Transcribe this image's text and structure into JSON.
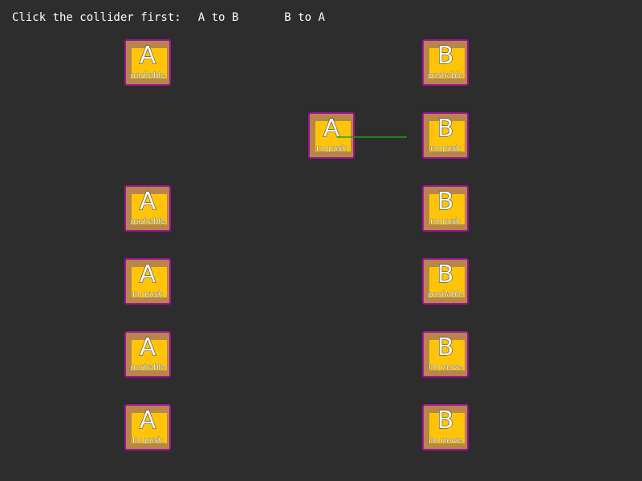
{
  "header": {
    "prompt": "Click the collider first:",
    "a_to_b": "A to B",
    "b_to_a": "B to A"
  },
  "colors": {
    "background": "#2d2d2d",
    "collider_border": "#a0119a",
    "collider_body": "#b8854a",
    "collider_face": "#ffc407",
    "link_line": "#1f9e1f"
  },
  "colliders": {
    "a1": {
      "letter": "A",
      "label": "pushable"
    },
    "b1": {
      "letter": "B",
      "label": "pushable"
    },
    "a_mid": {
      "letter": "A",
      "label": "no push"
    },
    "b2": {
      "letter": "B",
      "label": "no push"
    },
    "a3": {
      "letter": "A",
      "label": "pushable"
    },
    "b3": {
      "letter": "B",
      "label": "no push"
    },
    "a4": {
      "letter": "A",
      "label": "no push"
    },
    "b4": {
      "letter": "B",
      "label": "pushable"
    },
    "a5": {
      "letter": "A",
      "label": "pushable"
    },
    "b5": {
      "letter": "B",
      "label": "no move"
    },
    "a6": {
      "letter": "A",
      "label": "no push"
    },
    "b6": {
      "letter": "B",
      "label": "no move"
    }
  }
}
